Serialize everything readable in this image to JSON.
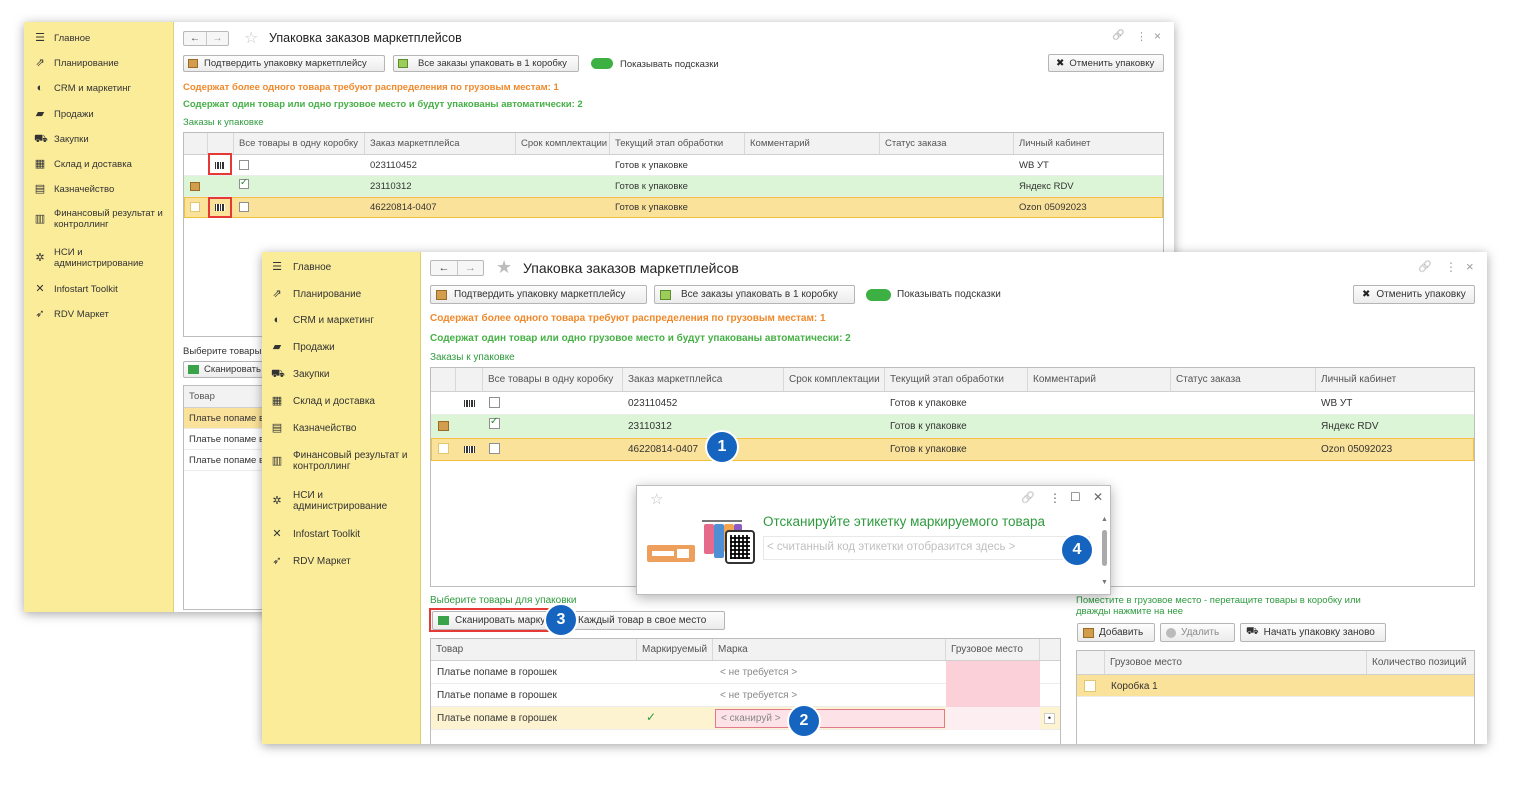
{
  "sidebar": {
    "items": [
      {
        "icon": "menu-icon",
        "glyph": "☰",
        "label": "Главное"
      },
      {
        "icon": "planning-icon",
        "glyph": "⇗",
        "label": "Планирование"
      },
      {
        "icon": "crm-icon",
        "glyph": "◐",
        "label": "CRM и маркетинг"
      },
      {
        "icon": "bag-icon",
        "glyph": "▰",
        "label": "Продажи"
      },
      {
        "icon": "cart-icon",
        "glyph": "⛟",
        "label": "Закупки"
      },
      {
        "icon": "warehouse-icon",
        "glyph": "▦",
        "label": "Склад и доставка"
      },
      {
        "icon": "treasury-icon",
        "glyph": "▤",
        "label": "Казначейство"
      },
      {
        "icon": "finance-chart-icon",
        "glyph": "▥",
        "label": "Финансовый результат и контроллинг"
      },
      {
        "icon": "settings-gear-icon",
        "glyph": "✲",
        "label": "НСИ и администрирование"
      },
      {
        "icon": "tools-icon",
        "glyph": "✕",
        "label": "Infostart Toolkit"
      },
      {
        "icon": "rocket-icon",
        "glyph": "➶",
        "label": "RDV Маркет"
      }
    ]
  },
  "window": {
    "title": "Упаковка заказов маркетплейсов",
    "back": "←",
    "forward": "→",
    "star": "☆",
    "link_glyph": "🔗",
    "more_glyph": "⋮",
    "close_glyph": "×"
  },
  "toolbar": {
    "confirm_label": "Подтвердить упаковку маркетплейсу",
    "pack_all_label": "Все заказы упаковать в 1 коробку",
    "hints_label": "Показывать подсказки",
    "cancel_label": "Отменить упаковку",
    "cancel_glyph": "✖"
  },
  "messages": {
    "multi": "Содержат более одного товара требуют распределения по грузовым местам: 1",
    "single": "Содержат один товар или одно грузовое место и будут упакованы автоматически: 2"
  },
  "orders": {
    "caption": "Заказы к упаковке",
    "columns": [
      "Все товары в одну коробку",
      "Заказ маркетплейса",
      "Срок комплектации",
      "Текущий этап обработки",
      "Комментарий",
      "Статус заказа",
      "Личный кабинет"
    ],
    "rows": [
      {
        "order": "023110452",
        "stage": "Готов к упаковке",
        "cabinet": "WB УТ",
        "checked": false
      },
      {
        "order": "23110312",
        "stage": "Готов к упаковке",
        "cabinet": "Яндекс RDV",
        "checked": true
      },
      {
        "order": "46220814-0407",
        "stage": "Готов к упаковке",
        "cabinet": "Ozon 05092023",
        "checked": false
      }
    ]
  },
  "goods": {
    "caption": "Выберите товары для упаковки",
    "caption_short": "Выберите товары",
    "scan_label": "Сканировать марку",
    "scan_short": "Сканировать",
    "each_label": "Каждый товар в свое место",
    "columns": [
      "Товар",
      "Маркируемый",
      "Марка",
      "Грузовое место"
    ],
    "rows": [
      {
        "product": "Платье попаме в горошек",
        "marked": "",
        "mark": "< не требуется >"
      },
      {
        "product": "Платье попаме в горошек",
        "marked": "",
        "mark": "< не требуется >"
      },
      {
        "product": "Платье попаме в горошек",
        "marked": "✓",
        "mark": "< сканируй >"
      }
    ],
    "product_short": "Платье попаме в"
  },
  "boxes": {
    "hint": "Поместите в грузовое место - перетащите товары в коробку или дважды нажмите на нее",
    "add_label": "Добавить",
    "delete_label": "Удалить",
    "restart_label": "Начать упаковку заново",
    "columns": [
      "Грузовое место",
      "Количество позиций"
    ],
    "rows": [
      {
        "name": "Коробка 1"
      }
    ]
  },
  "popup": {
    "star": "☆",
    "title": "Отсканируйте этикетку маркируемого товара",
    "placeholder": "< считанный код этикетки отобразится здесь >",
    "link_glyph": "🔗",
    "more_glyph": "⋮",
    "max_glyph": "☐",
    "close_glyph": "✕"
  },
  "callouts": [
    "1",
    "2",
    "3",
    "4"
  ]
}
